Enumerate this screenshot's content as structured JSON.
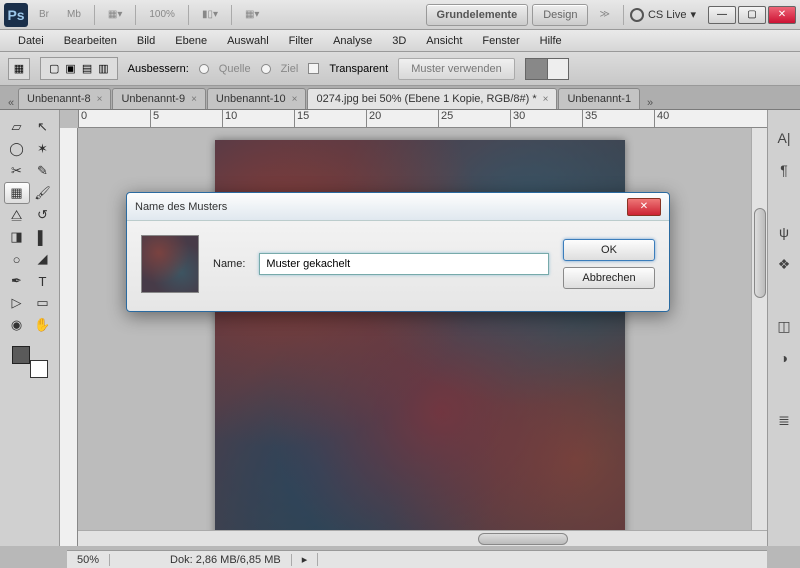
{
  "top": {
    "br": "Br",
    "mb": "Mb",
    "zoom": "100%",
    "mode_active": "Grundelemente",
    "mode_2": "Design",
    "cslive": "CS Live"
  },
  "menu": [
    "Datei",
    "Bearbeiten",
    "Bild",
    "Ebene",
    "Auswahl",
    "Filter",
    "Analyse",
    "3D",
    "Ansicht",
    "Fenster",
    "Hilfe"
  ],
  "options": {
    "ausbessern": "Ausbessern:",
    "quelle": "Quelle",
    "ziel": "Ziel",
    "transparent": "Transparent",
    "muster": "Muster verwenden"
  },
  "tabs": {
    "t1": "Unbenannt-8",
    "t2": "Unbenannt-9",
    "t3": "Unbenannt-10",
    "active": "0274.jpg bei 50% (Ebene 1 Kopie, RGB/8#) *",
    "t5": "Unbenannt-1"
  },
  "ruler_marks": [
    "0",
    "5",
    "10",
    "15",
    "20",
    "25",
    "30",
    "35",
    "40"
  ],
  "status": {
    "zoom": "50%",
    "doc": "Dok: 2,86 MB/6,85 MB"
  },
  "dialog": {
    "title": "Name des Musters",
    "label": "Name:",
    "value": "Muster gekachelt",
    "ok": "OK",
    "cancel": "Abbrechen"
  }
}
